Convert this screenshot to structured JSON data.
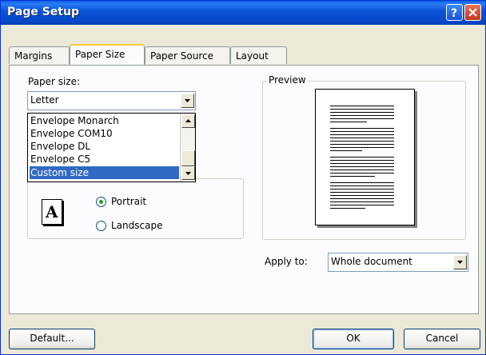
{
  "window": {
    "title": "Page Setup"
  },
  "tabs": [
    {
      "label": "Margins",
      "active": false
    },
    {
      "label": "Paper Size",
      "active": true
    },
    {
      "label": "Paper Source",
      "active": false
    },
    {
      "label": "Layout",
      "active": false
    }
  ],
  "paper_size": {
    "label": "Paper size:",
    "value": "Letter",
    "options": [
      "Envelope Monarch",
      "Envelope COM10",
      "Envelope DL",
      "Envelope C5",
      "Custom size"
    ],
    "selected_option": "Custom size"
  },
  "orientation": {
    "icon_letter": "A",
    "portrait_label": "Portrait",
    "landscape_label": "Landscape",
    "selected": "Portrait"
  },
  "preview": {
    "label": "Preview"
  },
  "apply_to": {
    "label": "Apply to:",
    "value": "Whole document"
  },
  "buttons": {
    "default": "Default...",
    "ok": "OK",
    "cancel": "Cancel"
  },
  "icons": [
    "help-icon",
    "close-icon",
    "dropdown-arrow-icon",
    "scroll-up-icon",
    "scroll-down-icon",
    "portrait-page-icon"
  ],
  "colors": {
    "titlebar": "#0A5FE8",
    "dialog": "#ECE9D8",
    "selection": "#316AC5",
    "active_tab": "#FFC83C"
  }
}
